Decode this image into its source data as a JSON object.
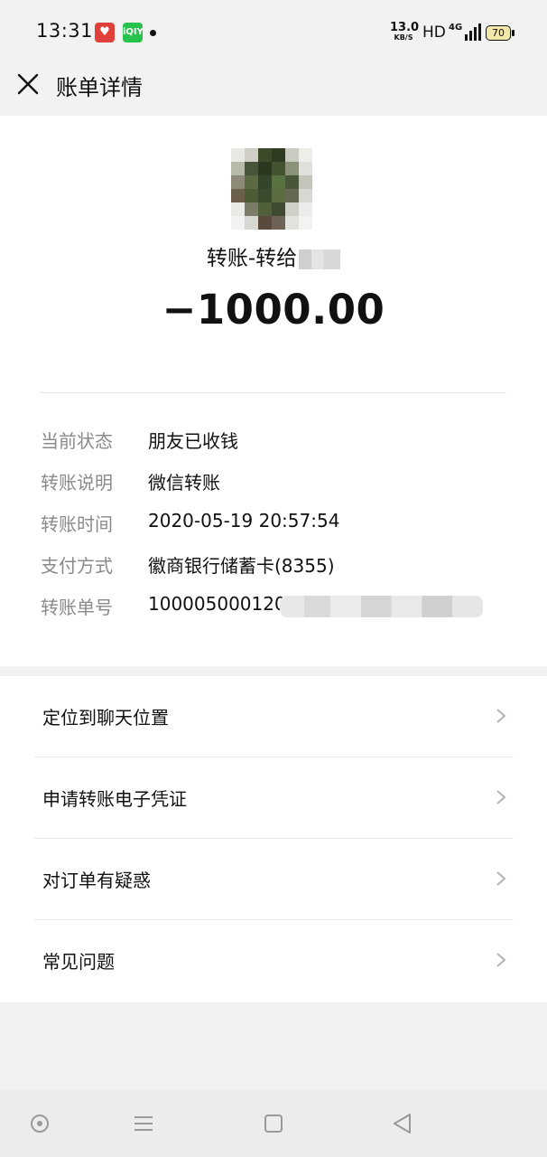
{
  "status_bar": {
    "time": "13:31",
    "app_icon_1": "gift-heart-icon",
    "app_icon_2": "iqiyi-icon",
    "app_icon_2_text": "iQIY",
    "net_speed_value": "13.0",
    "net_speed_unit": "KB/S",
    "hd": "HD",
    "network": "4G",
    "battery": "70"
  },
  "header": {
    "title": "账单详情"
  },
  "transaction": {
    "recipient": "转账-转给",
    "amount": "−1000.00",
    "details": [
      {
        "label": "当前状态",
        "value": "朋友已收钱"
      },
      {
        "label": "转账说明",
        "value": "微信转账"
      },
      {
        "label": "转账时间",
        "value": "2020-05-19 20:57:54"
      },
      {
        "label": "支付方式",
        "value": "徽商银行储蓄卡(8355)"
      },
      {
        "label": "转账单号",
        "value": "100005000120"
      }
    ]
  },
  "actions": [
    {
      "label": "定位到聊天位置"
    },
    {
      "label": "申请转账电子凭证"
    },
    {
      "label": "对订单有疑惑"
    },
    {
      "label": "常见问题"
    }
  ],
  "colors": {
    "background": "#f2f2f2",
    "card": "#ffffff",
    "muted_text": "#8a8a8a",
    "battery_fill": "#f0e7a8"
  }
}
